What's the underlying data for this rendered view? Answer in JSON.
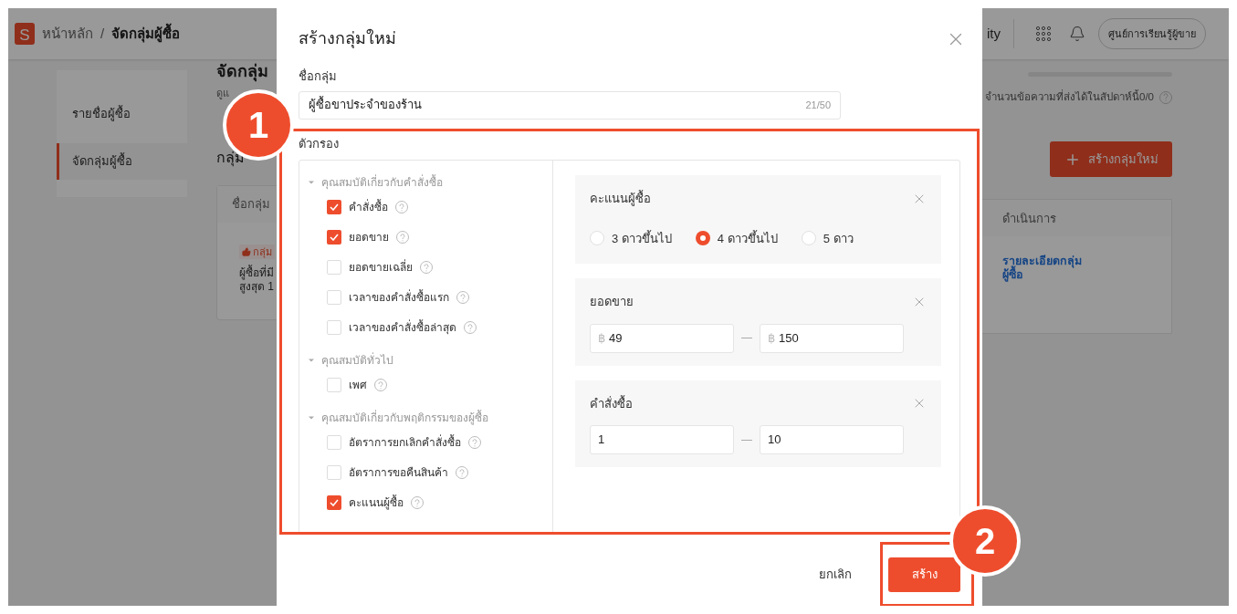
{
  "header": {
    "logo": "S",
    "breadcrumb_home": "หน้าหลัก",
    "breadcrumb_separator": "/",
    "breadcrumb_current": "จัดกลุ่มผู้ซื้อ",
    "nav_partial": "ity",
    "learning_center": "ศูนย์การเรียนรู้ผู้ขาย"
  },
  "sidebar": {
    "items": [
      {
        "label": "รายชื่อผู้ซื้อ",
        "selected": false
      },
      {
        "label": "จัดกลุ่มผู้ซื้อ",
        "selected": true
      }
    ]
  },
  "main": {
    "title": "จัดกลุ่ม",
    "subtitle": "ดูแ",
    "groups_heading": "กลุ่ม",
    "message_quota": "จำนวนข้อความที่ส่งได้ในสัปดาห์นี้0/0",
    "create_button": "สร้างกลุ่มใหม่",
    "table": {
      "columns": [
        "ชื่อกลุ่ม",
        "ดำเนินการ"
      ],
      "rows": [
        {
          "tag": "กลุ่ม",
          "description_lines": [
            "ผู้ซื้อที่มี",
            "สูงสุด 1"
          ],
          "action": "รายละเอียดกลุ่มผู้ซื้อ"
        }
      ]
    }
  },
  "dialog": {
    "title": "สร้างกลุ่มใหม่",
    "name_label": "ชื่อกลุ่ม",
    "name_value": "ผู้ซื้อขาประจำของร้าน",
    "name_count": "21/50",
    "filter_label": "ตัวกรอง",
    "filter_groups": [
      {
        "label": "คุณสมบัติเกี่ยวกับคำสั่งซื้อ",
        "expanded": true,
        "options": [
          {
            "label": "คำสั่งซื้อ",
            "checked": true
          },
          {
            "label": "ยอดขาย",
            "checked": true
          },
          {
            "label": "ยอดขายเฉลี่ย",
            "checked": false
          },
          {
            "label": "เวลาของคำสั่งซื้อแรก",
            "checked": false
          },
          {
            "label": "เวลาของคำสั่งซื้อล่าสุด",
            "checked": false
          }
        ]
      },
      {
        "label": "คุณสมบัติทั่วไป",
        "expanded": true,
        "options": [
          {
            "label": "เพศ",
            "checked": false
          }
        ]
      },
      {
        "label": "คุณสมบัติเกี่ยวกับพฤติกรรมของผู้ซื้อ",
        "expanded": true,
        "options": [
          {
            "label": "อัตราการยกเลิกคำสั่งซื้อ",
            "checked": false
          },
          {
            "label": "อัตราการขอคืนสินค้า",
            "checked": false
          },
          {
            "label": "คะแนนผู้ซื้อ",
            "checked": true
          }
        ]
      }
    ],
    "criteria": [
      {
        "kind": "radio",
        "title": "คะแนนผู้ซื้อ",
        "options": [
          {
            "label": "3 ดาวขึ้นไป",
            "selected": false
          },
          {
            "label": "4 ดาวขึ้นไป",
            "selected": true
          },
          {
            "label": "5 ดาว",
            "selected": false
          }
        ]
      },
      {
        "kind": "range",
        "title": "ยอดขาย",
        "prefix": "฿",
        "from": "49",
        "to": "150"
      },
      {
        "kind": "range",
        "title": "คำสั่งซื้อ",
        "from": "1",
        "to": "10"
      }
    ],
    "cancel": "ยกเลิก",
    "submit": "สร้าง"
  },
  "callouts": [
    {
      "number": "1"
    },
    {
      "number": "2"
    }
  ]
}
